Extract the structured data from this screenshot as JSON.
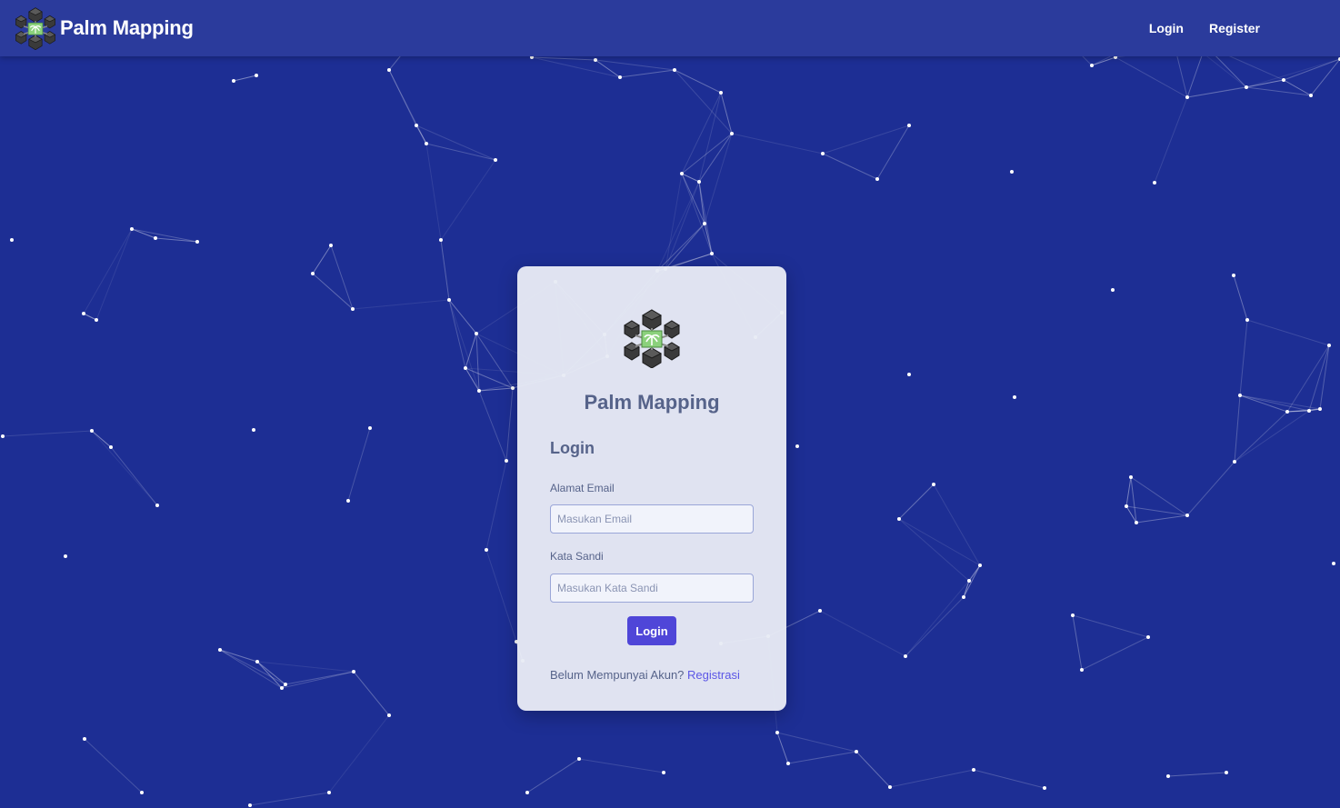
{
  "navbar": {
    "brand_name": "Palm Mapping",
    "links": [
      {
        "label": "Login"
      },
      {
        "label": "Register"
      }
    ]
  },
  "card": {
    "title": "Palm Mapping",
    "form_heading": "Login",
    "email": {
      "label": "Alamat Email",
      "placeholder": "Masukan Email",
      "value": ""
    },
    "password": {
      "label": "Kata Sandi",
      "placeholder": "Masukan Kata Sandi",
      "value": ""
    },
    "submit_label": "Login",
    "register_prompt": "Belum Mempunyai Akun?",
    "register_link": "Registrasi"
  },
  "colors": {
    "background": "#1d2e94",
    "navbar": "#2b3b9c",
    "card": "#e8ebf5",
    "accent": "#4f46d8",
    "link": "#5b56e6",
    "logo_green": "#8bd17c"
  },
  "icons": {
    "brand_logo": "blockchain-palm-icon",
    "card_logo": "blockchain-palm-icon"
  }
}
